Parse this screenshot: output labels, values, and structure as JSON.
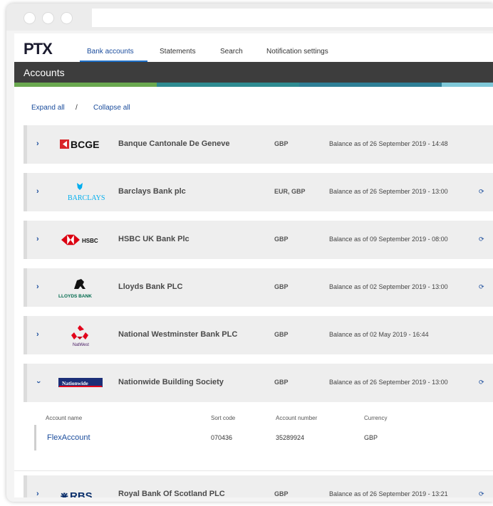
{
  "app": {
    "logo": "PTX"
  },
  "nav": {
    "tabs": [
      {
        "label": "Bank accounts",
        "active": true
      },
      {
        "label": "Statements",
        "active": false
      },
      {
        "label": "Search",
        "active": false
      },
      {
        "label": "Notification settings",
        "active": false
      }
    ]
  },
  "header": {
    "title": "Accounts"
  },
  "controls": {
    "expand_all": "Expand all",
    "separator": "/",
    "collapse_all": "Collapse all"
  },
  "banks": [
    {
      "logo": "BCGE",
      "name": "Banque Cantonale De Geneve",
      "currency": "GBP",
      "balance": "Balance as of 26 September 2019 - 14:48",
      "refresh": false
    },
    {
      "logo": "BARCLAYS",
      "name": "Barclays Bank plc",
      "currency": "EUR, GBP",
      "balance": "Balance as of 26 September 2019 - 13:00",
      "refresh": true
    },
    {
      "logo": "HSBC",
      "name": "HSBC UK Bank Plc",
      "currency": "GBP",
      "balance": "Balance as of 09 September 2019 - 08:00",
      "refresh": true
    },
    {
      "logo": "LLOYDS BANK",
      "name": "Lloyds Bank PLC",
      "currency": "GBP",
      "balance": "Balance as of 02 September 2019 - 13:00",
      "refresh": true
    },
    {
      "logo": "NatWest",
      "name": "National Westminster Bank PLC",
      "currency": "GBP",
      "balance": "Balance as of 02 May 2019 - 16:44",
      "refresh": false
    },
    {
      "logo": "Nationwide",
      "name": "Nationwide Building Society",
      "currency": "GBP",
      "balance": "Balance as of 26 September 2019 - 13:00",
      "refresh": true
    },
    {
      "logo": "RBS",
      "name": "Royal Bank Of Scotland PLC",
      "currency": "GBP",
      "balance": "Balance as of 26 September 2019 - 13:21",
      "refresh": true
    }
  ],
  "expanded": {
    "headers": {
      "account_name": "Account name",
      "sort_code": "Sort code",
      "account_number": "Account number",
      "currency": "Currency"
    },
    "rows": [
      {
        "account_name": "FlexAccount",
        "sort_code": "070436",
        "account_number": "35289924",
        "currency": "GBP"
      }
    ]
  },
  "icons": {
    "chevron": "chevron-right-icon",
    "chevron_open": "chevron-down-icon",
    "refresh": "refresh-icon"
  },
  "colors": {
    "accent": "#1e6fc7",
    "link": "#1a4c9c",
    "band": "#3d3d3d",
    "stripe_green": "#6aa84f",
    "stripe_teal": "#2e8b91",
    "stripe_lightblue": "#7fc8d8"
  }
}
